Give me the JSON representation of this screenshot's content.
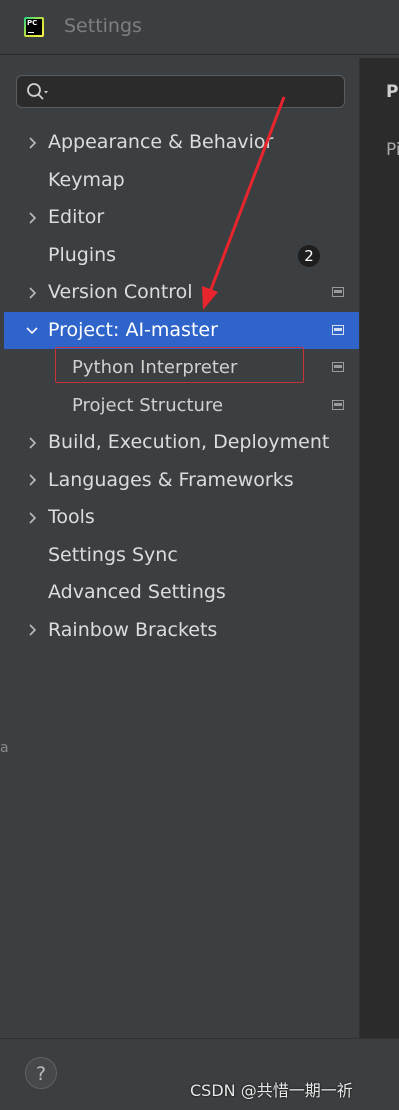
{
  "window": {
    "title": "Settings",
    "app_icon_text": "PC"
  },
  "search": {
    "value": "",
    "placeholder": ""
  },
  "tree": [
    {
      "label": "Appearance & Behavior",
      "expandable": true,
      "expanded": false
    },
    {
      "label": "Keymap",
      "expandable": false
    },
    {
      "label": "Editor",
      "expandable": true,
      "expanded": false
    },
    {
      "label": "Plugins",
      "expandable": false,
      "badge": "2"
    },
    {
      "label": "Version Control",
      "expandable": true,
      "expanded": false,
      "project_icon": true
    },
    {
      "label": "Project: AI-master",
      "expandable": true,
      "expanded": true,
      "selected": true,
      "project_icon": true
    },
    {
      "label": "Python Interpreter",
      "child": true,
      "project_icon": true,
      "highlighted": true
    },
    {
      "label": "Project Structure",
      "child": true,
      "project_icon": true
    },
    {
      "label": "Build, Execution, Deployment",
      "expandable": true,
      "expanded": false
    },
    {
      "label": "Languages & Frameworks",
      "expandable": true,
      "expanded": false
    },
    {
      "label": "Tools",
      "expandable": true,
      "expanded": false
    },
    {
      "label": "Settings Sync",
      "expandable": false
    },
    {
      "label": "Advanced Settings",
      "expandable": false
    },
    {
      "label": "Rainbow Brackets",
      "expandable": true,
      "expanded": false
    }
  ],
  "right_panel": {
    "heading_fragment": "P",
    "text_fragment": "Pi"
  },
  "footer": {
    "help_label": "?",
    "watermark": "CSDN @共惜一期一祈"
  },
  "edge_fragment": "a",
  "colors": {
    "selection": "#2f65ca",
    "highlight_box": "#c8323a",
    "arrow": "#e8242c",
    "badge_bg": "#1e1e1e"
  }
}
